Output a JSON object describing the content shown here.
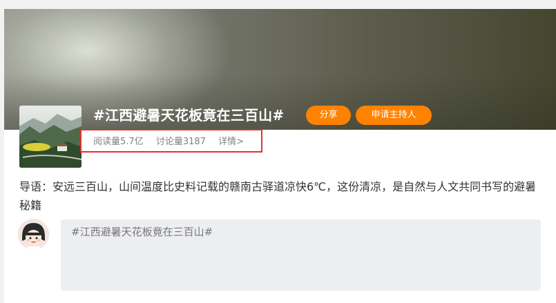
{
  "topic": {
    "title": "#江西避暑天花板竟在三百山#",
    "share_label": "分享",
    "host_label": "申请主持人",
    "reads": "阅读量5.7亿",
    "discussions": "讨论量3187",
    "details": "详情>",
    "lead": "导语：安远三百山，山间温度比史料记载的赣南古驿道凉快6℃，这份清凉，是自然与人文共同书写的避暑秘籍"
  },
  "composer": {
    "prefill": "#江西避暑天花板竟在三百山#"
  },
  "colors": {
    "accent": "#ff8200",
    "highlight": "#e3302d",
    "composer_bg": "#edeef2"
  },
  "icons": {
    "avatar": "cartoon-girl-avatar",
    "cover": "mountain-landscape-image"
  }
}
